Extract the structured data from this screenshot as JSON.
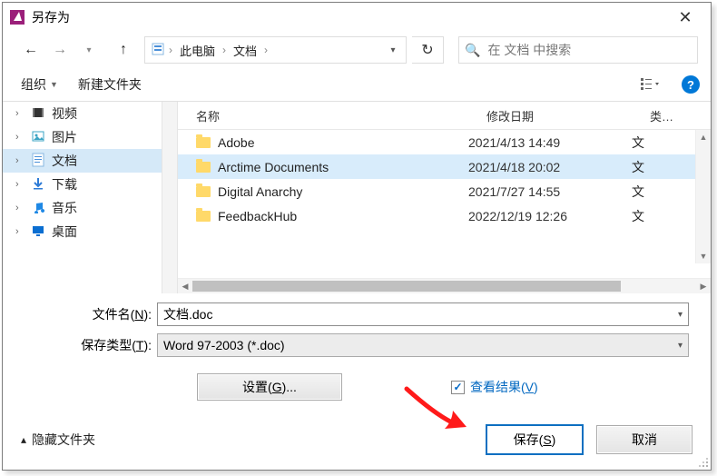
{
  "title": "另存为",
  "breadcrumb": {
    "seg1": "此电脑",
    "seg2": "文档"
  },
  "search": {
    "placeholder": "在 文档 中搜索"
  },
  "toolbar": {
    "organize": "组织",
    "newfolder": "新建文件夹"
  },
  "sidebar": {
    "items": [
      {
        "label": "视频",
        "icon": "🎞️",
        "selected": false
      },
      {
        "label": "图片",
        "icon": "🖼️",
        "selected": false
      },
      {
        "label": "文档",
        "icon": "📄",
        "selected": true
      },
      {
        "label": "下载",
        "icon": "⬇️",
        "selected": false
      },
      {
        "label": "音乐",
        "icon": "🎵",
        "selected": false
      },
      {
        "label": "桌面",
        "icon": "🖥️",
        "selected": false
      }
    ]
  },
  "headers": {
    "name": "名称",
    "modified": "修改日期",
    "type": "类…"
  },
  "files": [
    {
      "name": "Adobe",
      "modified": "2021/4/13 14:49",
      "type": "文",
      "selected": false
    },
    {
      "name": "Arctime Documents",
      "modified": "2021/4/18 20:02",
      "type": "文",
      "selected": true
    },
    {
      "name": "Digital Anarchy",
      "modified": "2021/7/27 14:55",
      "type": "文",
      "selected": false
    },
    {
      "name": "FeedbackHub",
      "modified": "2022/12/19 12:26",
      "type": "文",
      "selected": false
    }
  ],
  "form": {
    "filename_label_pre": "文件名(",
    "filename_label_ul": "N",
    "filename_label_post": "):",
    "filename_value": "文档.doc",
    "savetype_label_pre": "保存类型(",
    "savetype_label_ul": "T",
    "savetype_label_post": "):",
    "savetype_value": "Word 97-2003 (*.doc)",
    "settings_btn_pre": "设置(",
    "settings_btn_ul": "G",
    "settings_btn_post": ")...",
    "viewresult_pre": "查看结果(",
    "viewresult_ul": "V",
    "viewresult_post": ")"
  },
  "footer": {
    "hide_folders": "隐藏文件夹",
    "save_pre": "保存(",
    "save_ul": "S",
    "save_post": ")",
    "cancel": "取消"
  }
}
